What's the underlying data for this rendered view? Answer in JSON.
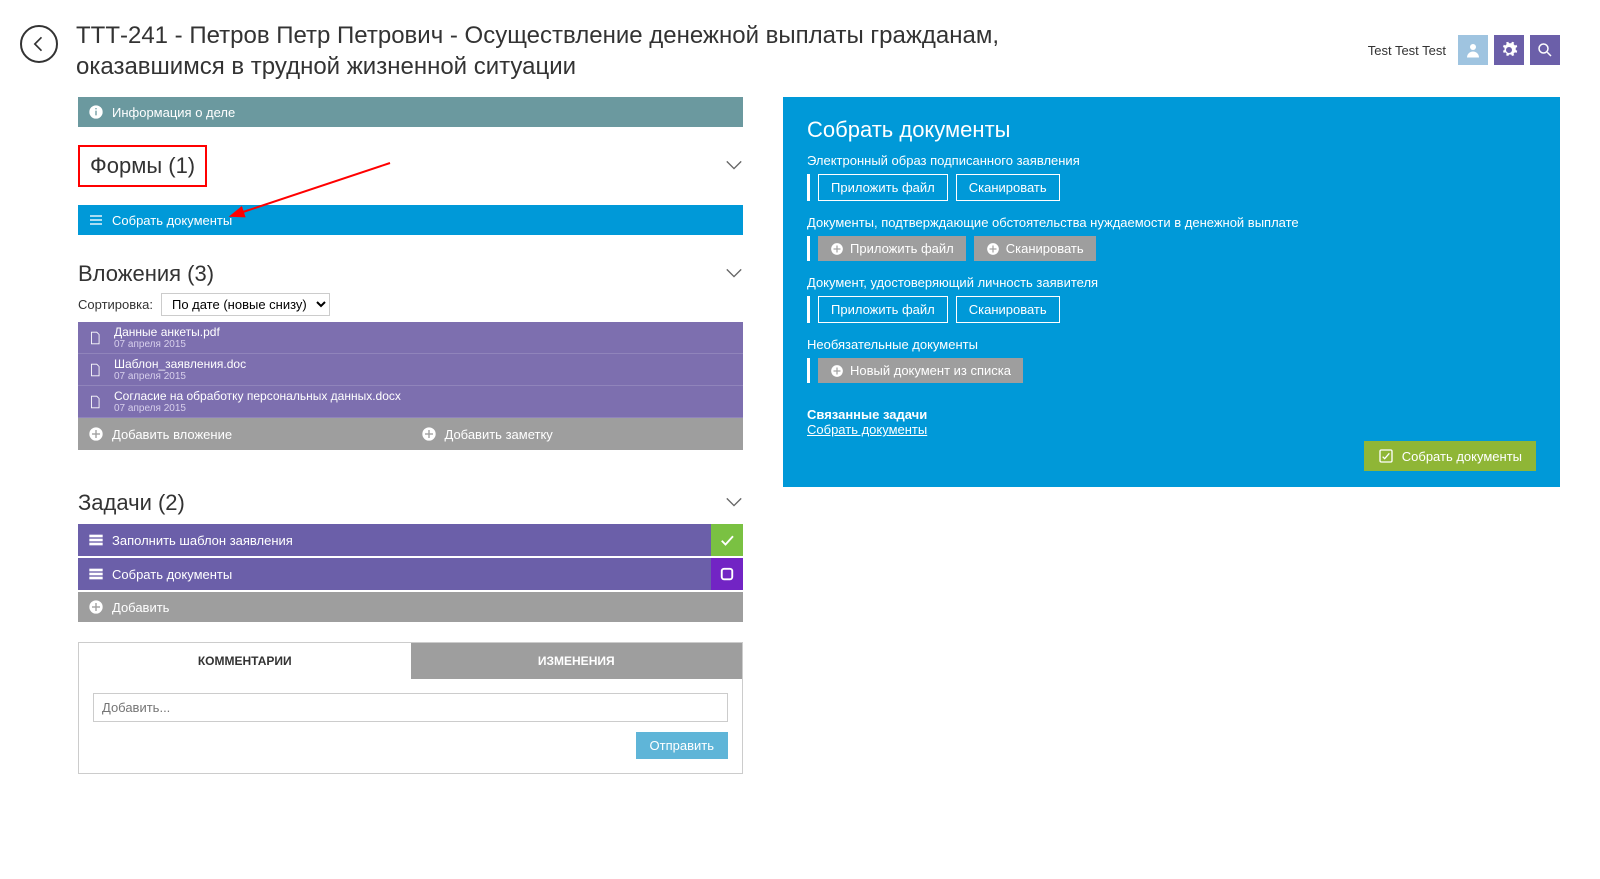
{
  "header": {
    "title": "ТТТ-241 -  Петров Петр  Петрович - Осуществление денежной выплаты гражданам, оказавшимся в трудной жизненной ситуации",
    "user": "Test Test Test"
  },
  "info_bar": "Информация о деле",
  "forms": {
    "title": "Формы (1)",
    "collect_docs": "Собрать документы"
  },
  "attachments": {
    "title": "Вложения (3)",
    "sort_label": "Сортировка:",
    "sort_value": "По дате (новые снизу)",
    "items": [
      {
        "name": "Данные анкеты.pdf",
        "date": "07 апреля 2015"
      },
      {
        "name": "Шаблон_заявления.doc",
        "date": "07 апреля 2015"
      },
      {
        "name": "Согласие на обработку персональных данных.docx",
        "date": "07 апреля 2015"
      }
    ],
    "add_attachment": "Добавить вложение",
    "add_note": "Добавить заметку"
  },
  "tasks": {
    "title": "Задачи (2)",
    "items": [
      {
        "name": "Заполнить шаблон заявления",
        "status": "done"
      },
      {
        "name": "Собрать документы",
        "status": "pending"
      }
    ],
    "add": "Добавить"
  },
  "comments": {
    "tab_comments": "КОММЕНТАРИИ",
    "tab_changes": "ИЗМЕНЕНИЯ",
    "placeholder": "Добавить...",
    "send": "Отправить"
  },
  "panel": {
    "title": "Собрать документы",
    "groups": [
      {
        "label": "Электронный образ подписанного заявления",
        "attach": "Приложить файл",
        "scan": "Сканировать",
        "style": "outline"
      },
      {
        "label": "Документы, подтверждающие обстоятельства нуждаемости в денежной выплате",
        "attach": "Приложить файл",
        "scan": "Сканировать",
        "style": "gray"
      },
      {
        "label": "Документ, удостоверяющий личность заявителя",
        "attach": "Приложить файл",
        "scan": "Сканировать",
        "style": "outline"
      }
    ],
    "optional_label": "Необязательные документы",
    "optional_btn": "Новый документ из списка",
    "related_title": "Связанные задачи",
    "related_link": "Собрать документы",
    "action": "Собрать документы"
  }
}
